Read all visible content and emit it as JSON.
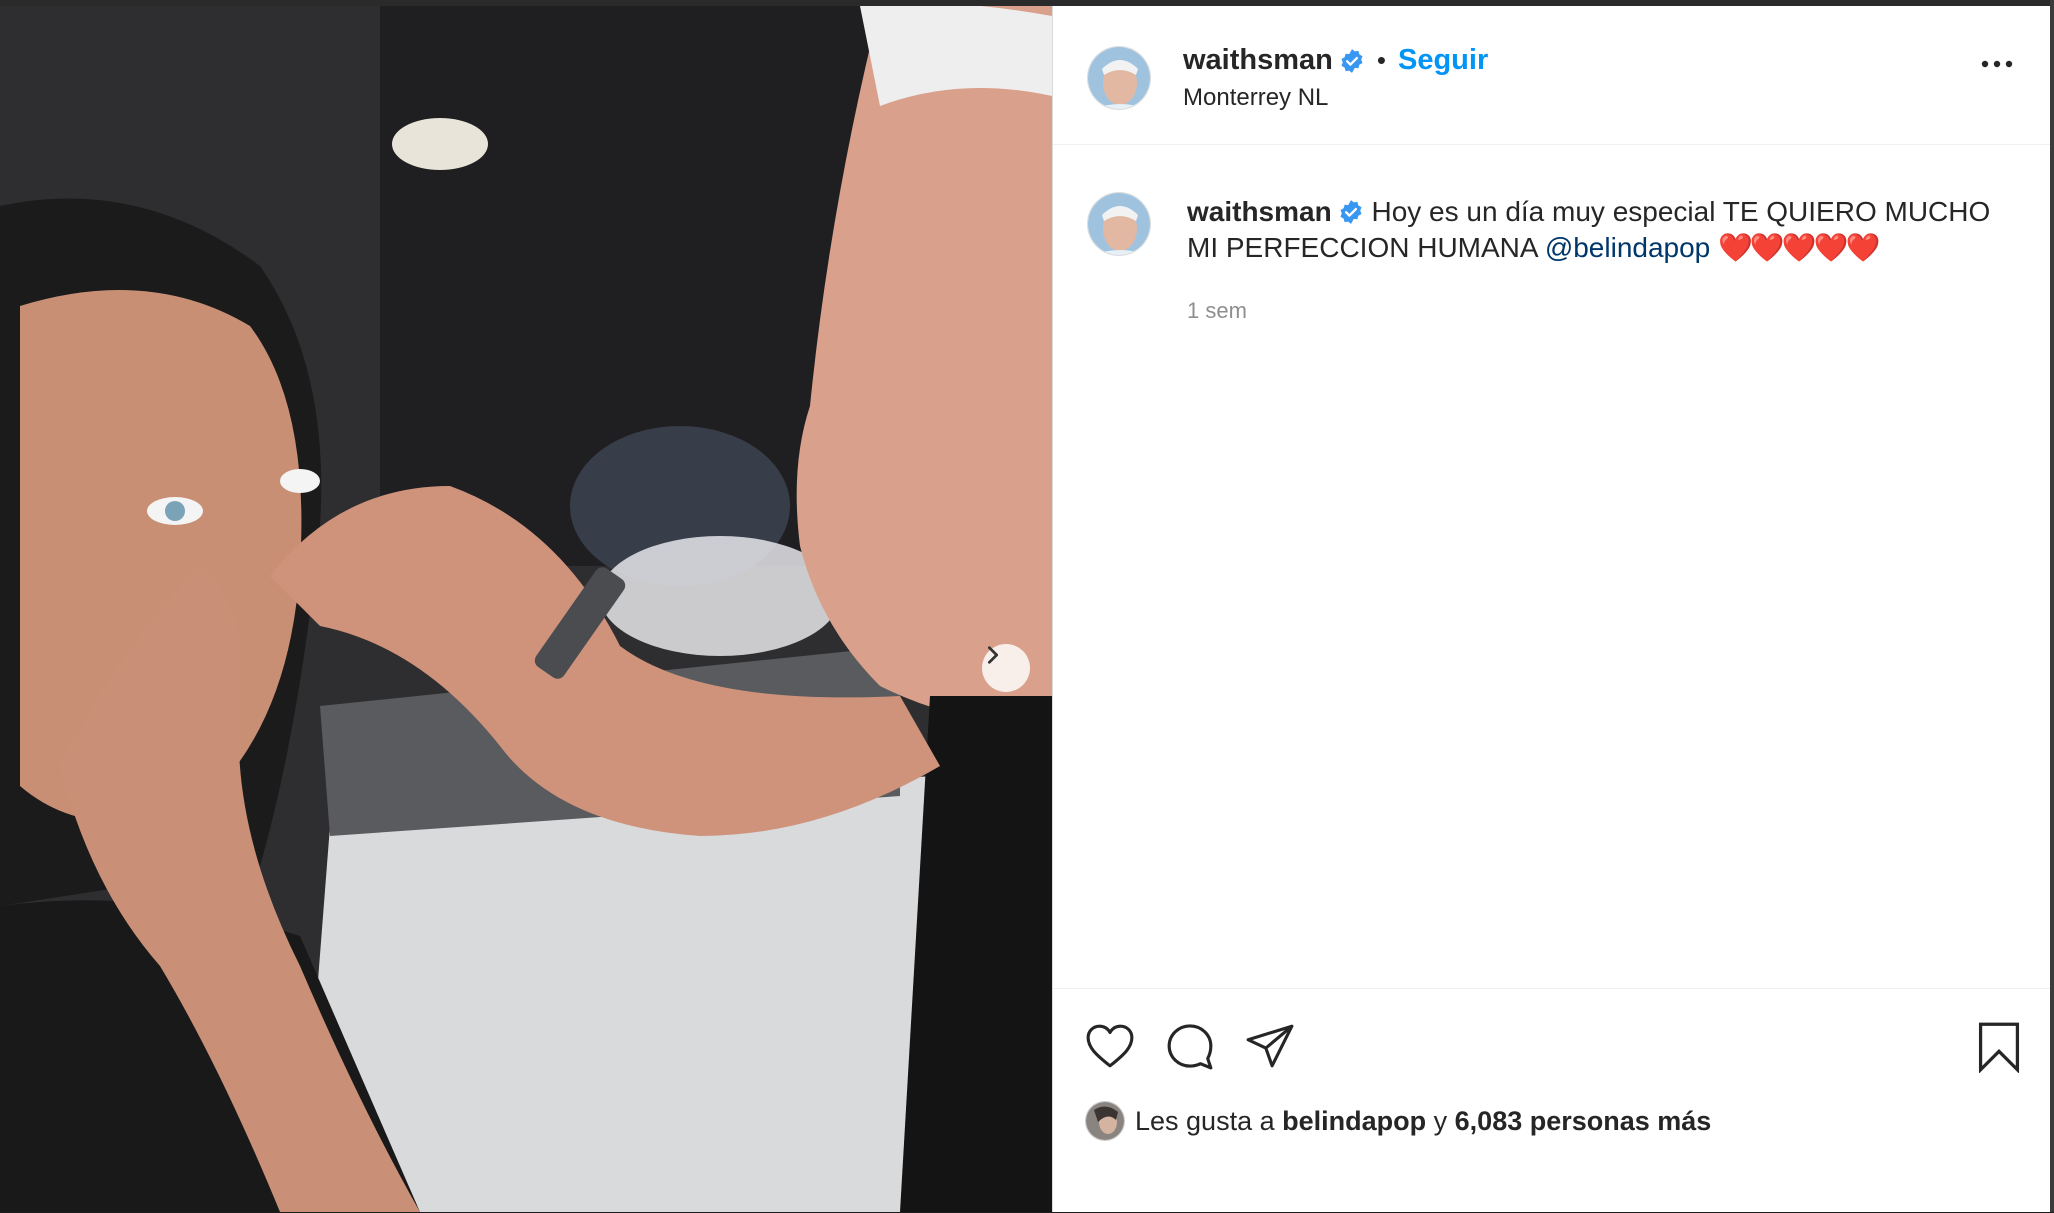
{
  "post": {
    "username": "waithsman",
    "separator": "•",
    "follow_label": "Seguir",
    "location": "Monterrey NL",
    "caption_text": "Hoy es un día muy especial TE QUIERO MUCHO MI PERFECCION HUMANA",
    "caption_mention": "@belindapop",
    "caption_emoji": "❤️❤️❤️❤️❤️",
    "time_ago": "1 sem",
    "likes_prefix": "Les gusta a",
    "likes_user": "belindapop",
    "likes_conjunction": "y",
    "likes_count_text": "6,083 personas más"
  },
  "colors": {
    "follow": "#0095f6",
    "verified": "#3897f0",
    "mention": "#00376b"
  },
  "icons": [
    "verified-badge-icon",
    "more-options-icon",
    "chevron-right-icon",
    "heart-icon",
    "comment-icon",
    "share-icon",
    "bookmark-icon"
  ]
}
